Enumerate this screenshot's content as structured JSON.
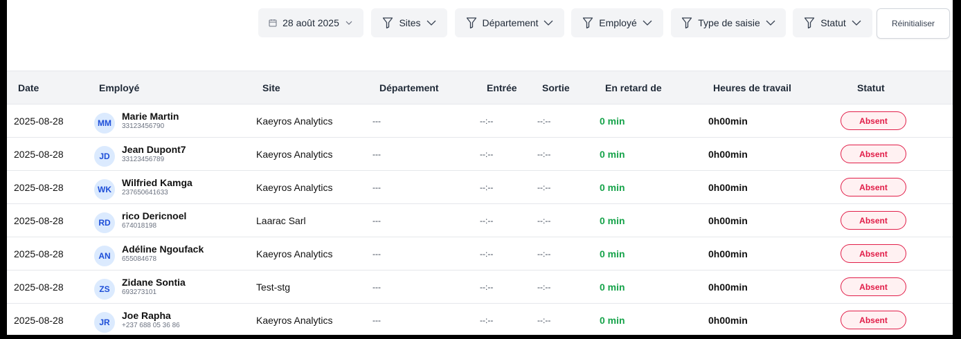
{
  "filters": {
    "date": "28 août 2025",
    "sites": "Sites",
    "department": "Département",
    "employee": "Employé",
    "entry_type": "Type de saisie",
    "status": "Statut",
    "reset": "Réinitialiser"
  },
  "table": {
    "headers": {
      "date": "Date",
      "employee": "Employé",
      "site": "Site",
      "department": "Département",
      "entry": "Entrée",
      "exit": "Sortie",
      "late": "En retard de",
      "hours": "Heures de travail",
      "status": "Statut"
    },
    "rows": [
      {
        "date": "2025-08-28",
        "initials": "MM",
        "name": "Marie Martin",
        "phone": "33123456790",
        "site": "Kaeyros Analytics",
        "department": "---",
        "entry": "--:--",
        "exit": "--:--",
        "late": "0 min",
        "hours": "0h00min",
        "status": "Absent"
      },
      {
        "date": "2025-08-28",
        "initials": "JD",
        "name": "Jean Dupont7",
        "phone": "33123456789",
        "site": "Kaeyros Analytics",
        "department": "---",
        "entry": "--:--",
        "exit": "--:--",
        "late": "0 min",
        "hours": "0h00min",
        "status": "Absent"
      },
      {
        "date": "2025-08-28",
        "initials": "WK",
        "name": "Wilfried Kamga",
        "phone": "237650641633",
        "site": "Kaeyros Analytics",
        "department": "---",
        "entry": "--:--",
        "exit": "--:--",
        "late": "0 min",
        "hours": "0h00min",
        "status": "Absent"
      },
      {
        "date": "2025-08-28",
        "initials": "RD",
        "name": "rico Dericnoel",
        "phone": "674018198",
        "site": "Laarac Sarl",
        "department": "---",
        "entry": "--:--",
        "exit": "--:--",
        "late": "0 min",
        "hours": "0h00min",
        "status": "Absent"
      },
      {
        "date": "2025-08-28",
        "initials": "AN",
        "name": "Adéline Ngoufack",
        "phone": "655084678",
        "site": "Kaeyros Analytics",
        "department": "---",
        "entry": "--:--",
        "exit": "--:--",
        "late": "0 min",
        "hours": "0h00min",
        "status": "Absent"
      },
      {
        "date": "2025-08-28",
        "initials": "ZS",
        "name": "Zidane Sontia",
        "phone": "693273101",
        "site": "Test-stg",
        "department": "---",
        "entry": "--:--",
        "exit": "--:--",
        "late": "0 min",
        "hours": "0h00min",
        "status": "Absent"
      },
      {
        "date": "2025-08-28",
        "initials": "JR",
        "name": "Joe Rapha",
        "phone": "+237 688 05 36 86",
        "site": "Kaeyros Analytics",
        "department": "---",
        "entry": "--:--",
        "exit": "--:--",
        "late": "0 min",
        "hours": "0h00min",
        "status": "Absent"
      }
    ]
  },
  "colors": {
    "late_green": "#16a34a",
    "absent_red": "#e11d48",
    "avatar_bg": "#dbeafe",
    "avatar_text": "#1d4ed8"
  },
  "icons": {
    "date": "calendar-icon",
    "filter": "filter-funnel-icon",
    "dropdown": "chevron-down-icon"
  }
}
